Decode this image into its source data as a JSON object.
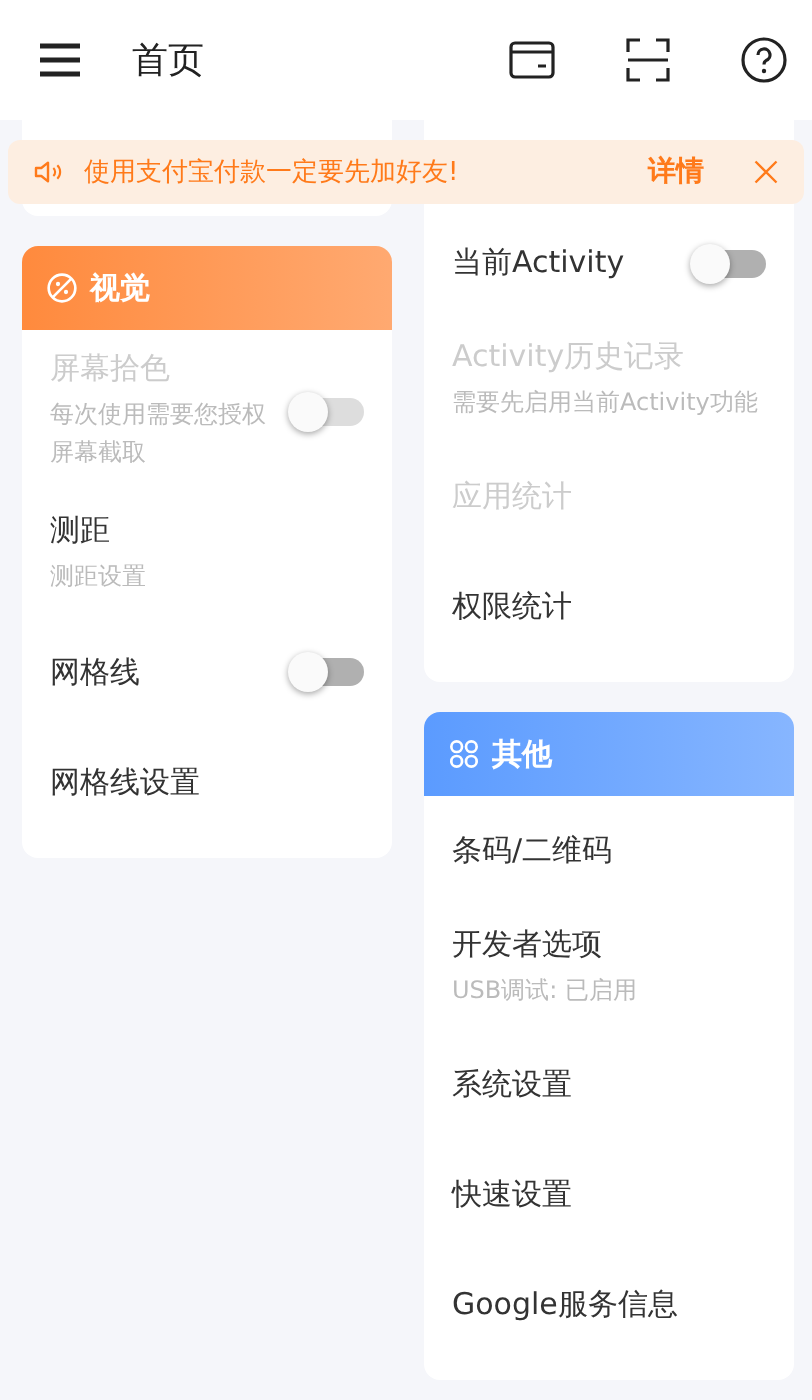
{
  "header": {
    "title": "首页"
  },
  "notice": {
    "text": "使用支付宝付款一定要先加好友!",
    "action": "详情"
  },
  "columns": [
    [
      {
        "title": "视觉",
        "color": "#ff8a3d",
        "items": [
          {
            "kind": "toggle",
            "title": "屏幕拾色",
            "subtitle": "每次使用需要您授权屏幕截取",
            "disabled": true,
            "on": false
          },
          {
            "kind": "link",
            "title": "测距",
            "subtitle": "测距设置",
            "disabled": false
          },
          {
            "kind": "toggle",
            "title": "网格线",
            "disabled": false,
            "on": false
          },
          {
            "kind": "link",
            "title": "网格线设置",
            "disabled": false
          }
        ]
      }
    ],
    [
      {
        "items": [
          {
            "kind": "toggle",
            "title": "当前Activity",
            "disabled": false,
            "on": false
          },
          {
            "kind": "link",
            "title": "Activity历史记录",
            "subtitle": "需要先启用当前Activity功能",
            "disabled": true
          },
          {
            "kind": "link",
            "title": "应用统计",
            "disabled": true
          },
          {
            "kind": "link",
            "title": "权限统计",
            "disabled": false
          }
        ]
      },
      {
        "title": "其他",
        "color": "#5b9bff",
        "items": [
          {
            "kind": "link",
            "title": "条码/二维码",
            "disabled": false
          },
          {
            "kind": "link",
            "title": "开发者选项",
            "subtitle": "USB调试: 已启用",
            "disabled": false
          },
          {
            "kind": "link",
            "title": "系统设置",
            "disabled": false
          },
          {
            "kind": "link",
            "title": "快速设置",
            "disabled": false
          },
          {
            "kind": "link",
            "title": "Google服务信息",
            "disabled": false
          }
        ]
      }
    ]
  ]
}
